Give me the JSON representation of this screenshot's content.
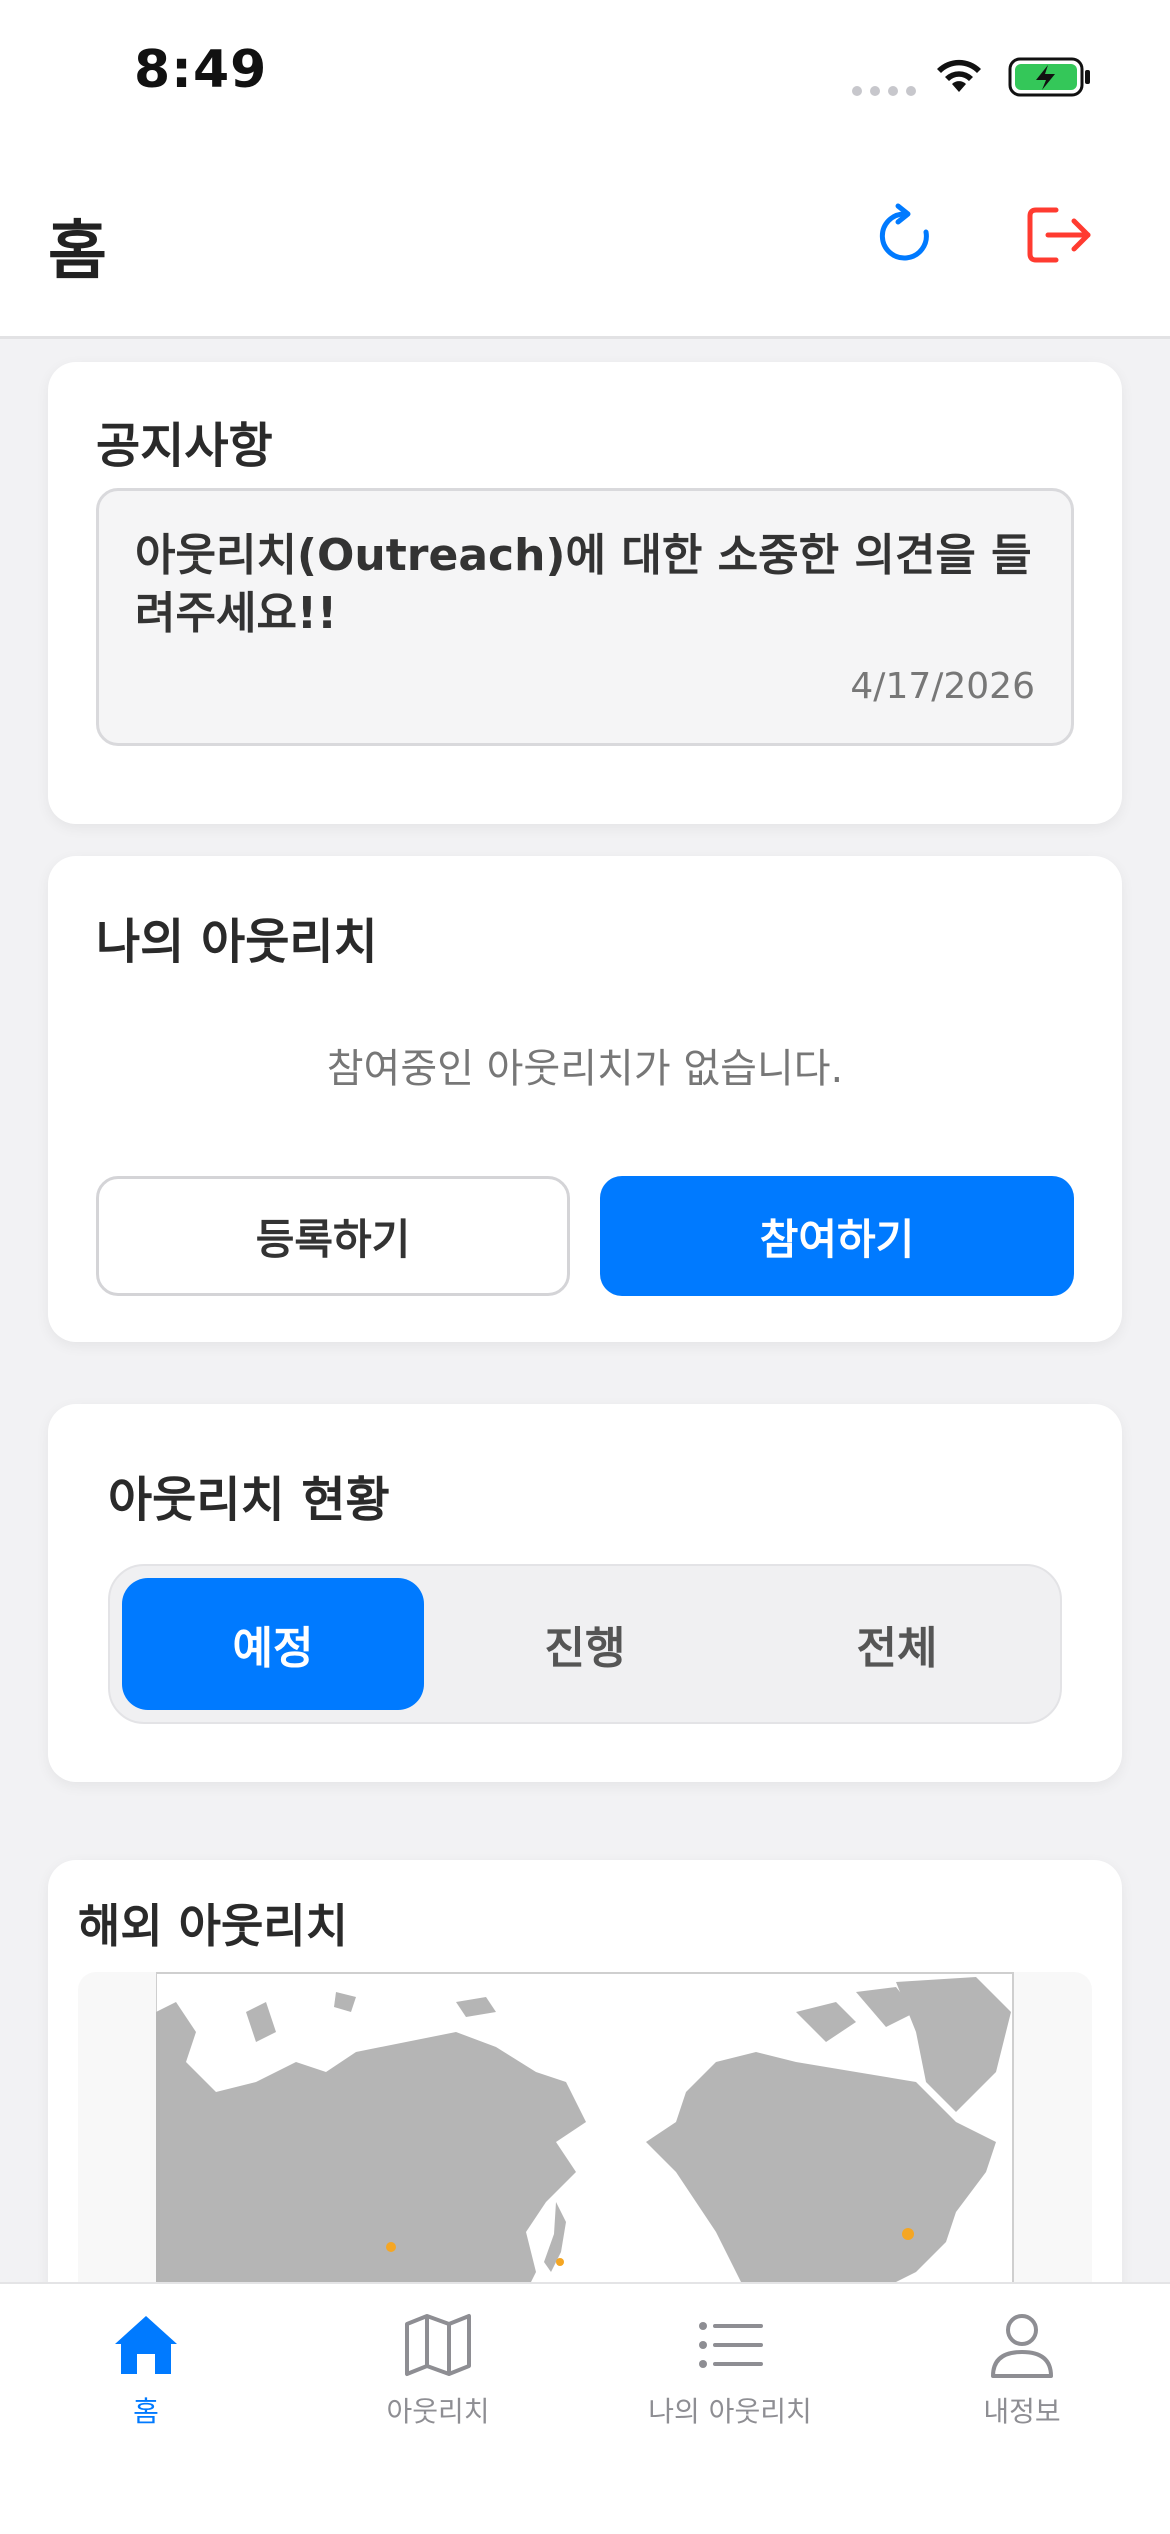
{
  "status_bar": {
    "time": "8:49"
  },
  "header": {
    "title": "홈",
    "refresh_icon": "refresh-icon",
    "logout_icon": "logout-icon"
  },
  "notice": {
    "title": "공지사항",
    "message": "아웃리치(Outreach)에 대한 소중한 의견을 들려주세요!!",
    "date": "4/17/2026"
  },
  "my_outreach": {
    "title": "나의 아웃리치",
    "empty_text": "참여중인 아웃리치가 없습니다.",
    "register_label": "등록하기",
    "join_label": "참여하기"
  },
  "outreach_status": {
    "title": "아웃리치 현황",
    "tabs": [
      {
        "label": "예정",
        "active": true
      },
      {
        "label": "진행",
        "active": false
      },
      {
        "label": "전체",
        "active": false
      }
    ]
  },
  "overseas": {
    "title": "해외 아웃리치"
  },
  "tab_bar": {
    "items": [
      {
        "label": "홈",
        "icon": "home-icon",
        "active": true
      },
      {
        "label": "아웃리치",
        "icon": "map-icon",
        "active": false
      },
      {
        "label": "나의 아웃리치",
        "icon": "list-icon",
        "active": false
      },
      {
        "label": "내정보",
        "icon": "person-icon",
        "active": false
      }
    ]
  },
  "colors": {
    "accent": "#007aff",
    "logout": "#ff3b30",
    "map_land": "#b5b5b5",
    "map_marker": "#f5a623"
  }
}
